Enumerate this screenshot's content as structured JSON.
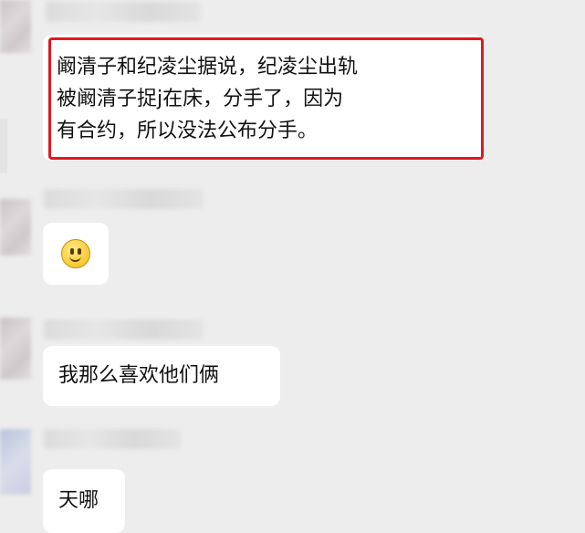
{
  "messages": [
    {
      "text": "阚清子和纪凌尘据说，纪凌尘出轨\n被阚清子捉j在床，分手了，因为\n有合约，所以没法公布分手。",
      "highlighted": true
    },
    {
      "emoji": "smiling-face"
    },
    {
      "text": "我那么喜欢他们俩"
    },
    {
      "text": "天哪"
    }
  ],
  "colors": {
    "background": "#ededed",
    "bubble": "#ffffff",
    "highlight": "#e0191f"
  }
}
